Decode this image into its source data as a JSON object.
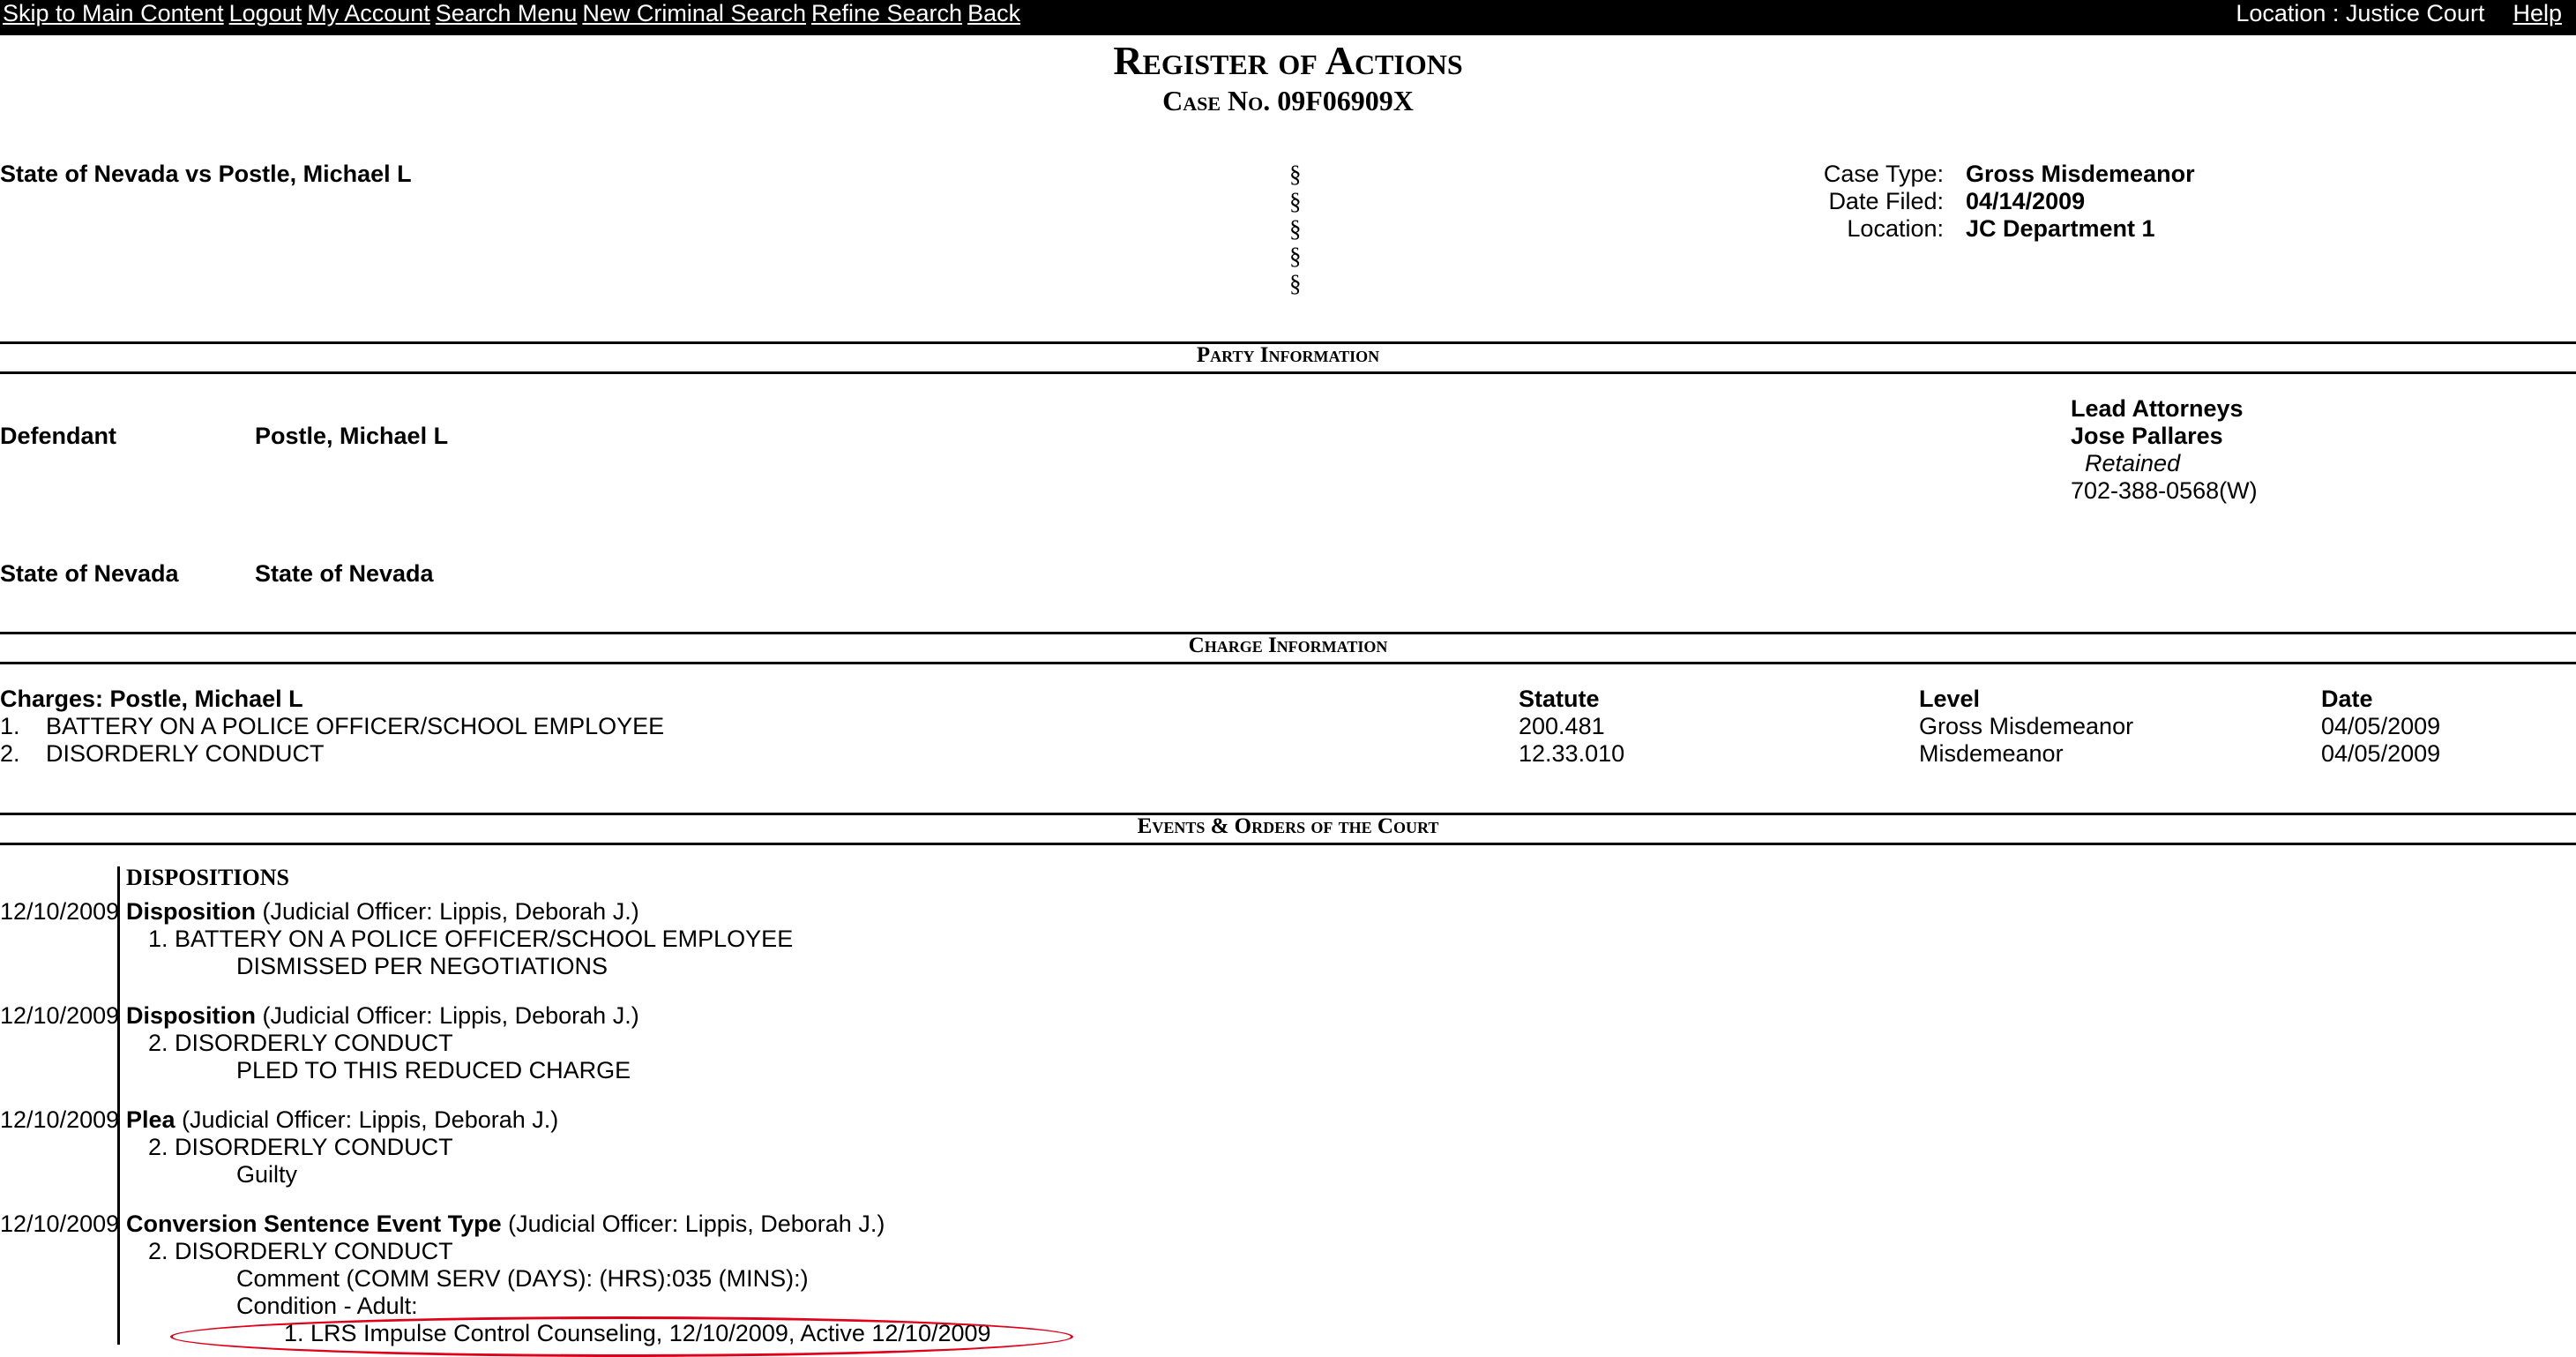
{
  "nav": {
    "links": [
      "Skip to Main Content",
      "Logout",
      "My Account",
      "Search Menu",
      "New Criminal Search",
      "Refine Search",
      "Back"
    ],
    "location": "Location : Justice Court",
    "help": "Help"
  },
  "header": {
    "title": "Register of Actions",
    "case_no": "Case No. 09F06909X"
  },
  "case": {
    "style": "State of Nevada vs Postle, Michael L",
    "section_symbols": [
      "§",
      "§",
      "§",
      "§",
      "§"
    ],
    "case_type_label": "Case Type:",
    "case_type": "Gross Misdemeanor",
    "date_filed_label": "Date Filed:",
    "date_filed": "04/14/2009",
    "location_label": "Location:",
    "location": "JC Department 1"
  },
  "sections": {
    "party": "Party Information",
    "charge": "Charge Information",
    "events": "Events & Orders of the Court"
  },
  "party": {
    "defendant_label": "Defendant",
    "defendant_name": "Postle, Michael L",
    "lead_attorneys_label": "Lead Attorneys",
    "attorney_name": "Jose Pallares",
    "attorney_status": "Retained",
    "attorney_phone": "702-388-0568(W)",
    "plaintiff_label": "State of Nevada",
    "plaintiff_name": "State of Nevada"
  },
  "charges": {
    "header_label": "Charges: Postle, Michael L",
    "col_statute": "Statute",
    "col_level": "Level",
    "col_date": "Date",
    "rows": [
      {
        "num": "1.",
        "desc": "BATTERY ON A POLICE OFFICER/SCHOOL EMPLOYEE",
        "statute": "200.481",
        "level": "Gross Misdemeanor",
        "date": "04/05/2009"
      },
      {
        "num": "2.",
        "desc": "DISORDERLY CONDUCT",
        "statute": "12.33.010",
        "level": "Misdemeanor",
        "date": "04/05/2009"
      }
    ]
  },
  "events": {
    "heading": "DISPOSITIONS",
    "items": [
      {
        "date": "12/10/2009",
        "type": "Disposition",
        "officer": "(Judicial Officer: Lippis, Deborah J.)",
        "charge": "1. BATTERY ON A POLICE OFFICER/SCHOOL EMPLOYEE",
        "detail": "DISMISSED PER NEGOTIATIONS"
      },
      {
        "date": "12/10/2009",
        "type": "Disposition",
        "officer": "(Judicial Officer: Lippis, Deborah J.)",
        "charge": "2. DISORDERLY CONDUCT",
        "detail": "PLED TO THIS REDUCED CHARGE"
      },
      {
        "date": "12/10/2009",
        "type": "Plea",
        "officer": "(Judicial Officer: Lippis, Deborah J.)",
        "charge": "2. DISORDERLY CONDUCT",
        "detail": "Guilty"
      },
      {
        "date": "12/10/2009",
        "type": "Conversion Sentence Event Type",
        "officer": "(Judicial Officer: Lippis, Deborah J.)",
        "charge": "2. DISORDERLY CONDUCT",
        "detail": "Comment (COMM SERV (DAYS): (HRS):035 (MINS):)",
        "condition": "Condition - Adult:",
        "condition_item": "1. LRS Impulse Control Counseling, 12/10/2009, Active 12/10/2009"
      }
    ]
  },
  "colors": {
    "topbar": "#000000",
    "highlight_oval": "#e0001a"
  }
}
